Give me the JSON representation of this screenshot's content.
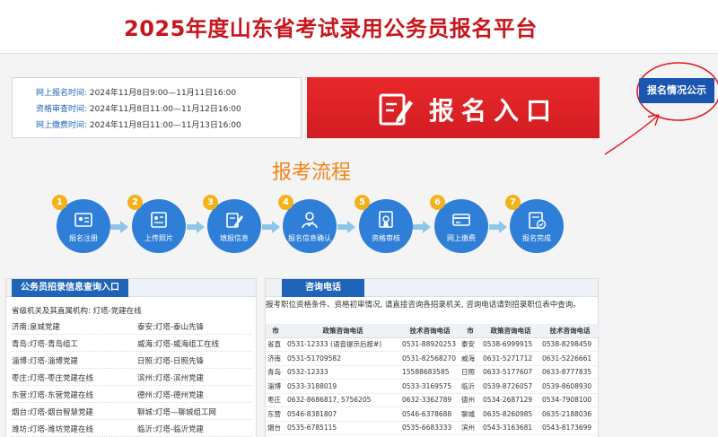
{
  "header": {
    "title": "2025年度山东省考试录用公务员报名平台"
  },
  "schedule": [
    {
      "label": "网上报名时间:",
      "value": "2024年11月8日9:00—11月11日16:00"
    },
    {
      "label": "资格审查时间:",
      "value": "2024年11月8日11:00—11月12日16:00"
    },
    {
      "label": "网上缴费时间:",
      "value": "2024年11月8日11:00—11月13日16:00"
    }
  ],
  "entry_button": {
    "label": "报名入口",
    "icon": "edit-form-icon"
  },
  "publicity_button": {
    "label": "报名情况公示"
  },
  "annotation": {
    "color": "#e0161d"
  },
  "flow": {
    "title": "报考流程",
    "steps": [
      {
        "num": "1",
        "label": "报名注册",
        "icon": "id-card-icon"
      },
      {
        "num": "2",
        "label": "上传照片",
        "icon": "photo-icon"
      },
      {
        "num": "3",
        "label": "填报信息",
        "icon": "write-icon"
      },
      {
        "num": "4",
        "label": "报名信息确认",
        "icon": "user-confirm-icon"
      },
      {
        "num": "5",
        "label": "资格审核",
        "icon": "certificate-icon"
      },
      {
        "num": "6",
        "label": "网上缴费",
        "icon": "payment-card-icon"
      },
      {
        "num": "7",
        "label": "报名完成",
        "icon": "check-document-icon"
      }
    ]
  },
  "left_panel": {
    "tab": "公务员招录信息查询入口",
    "intro": "省级机关及其直属机构:  灯塔-党建在线",
    "rows": [
      [
        {
          "city": "济南:",
          "link": "泉城党建"
        },
        {
          "city": "泰安:",
          "link": "灯塔-泰山先锋"
        }
      ],
      [
        {
          "city": "青岛:",
          "link": "灯塔-青岛组工"
        },
        {
          "city": "威海:",
          "link": "灯塔-威海组工在线"
        }
      ],
      [
        {
          "city": "淄博:",
          "link": "灯塔-淄博党建"
        },
        {
          "city": "日照:",
          "link": "灯塔-日照先锋"
        }
      ],
      [
        {
          "city": "枣庄:",
          "link": "灯塔-枣庄党建在线"
        },
        {
          "city": "滨州:",
          "link": "灯塔-滨州党建"
        }
      ],
      [
        {
          "city": "东营:",
          "link": "灯塔-东营党建在线"
        },
        {
          "city": "德州:",
          "link": "灯塔-德州党建"
        }
      ],
      [
        {
          "city": "烟台:",
          "link": "灯塔-烟台智慧党建"
        },
        {
          "city": "聊城:",
          "link": "灯塔—聊城组工网"
        }
      ],
      [
        {
          "city": "潍坊:",
          "link": "灯塔-潍坊党建在线"
        },
        {
          "city": "临沂:",
          "link": "灯塔-临沂党建"
        }
      ]
    ]
  },
  "right_panel": {
    "tab": "咨询电话",
    "note": "报考职位资格条件、资格初审情况, 请直接咨询各招录机关, 咨询电话请到招录职位表中查询。",
    "headers": [
      "市",
      "政策咨询电话",
      "技术咨询电话",
      "市",
      "政策咨询电话",
      "技术咨询电话"
    ],
    "rows": [
      [
        "省直",
        "0531-12333 (语音提示后按#)",
        "0531-88920253",
        "泰安",
        "0538-6999915",
        "0538-8298459"
      ],
      [
        "济南",
        "0531-51709582",
        "0531-82568270",
        "威海",
        "0631-5271712",
        "0631-5226661"
      ],
      [
        "青岛",
        "0532-12333",
        "15588683585",
        "日照",
        "0633-5177607",
        "0633-8777835"
      ],
      [
        "淄博",
        "0533-3188019",
        "0533-3169575",
        "临沂",
        "0539-8726057",
        "0539-8608930"
      ],
      [
        "枣庄",
        "0632-8686817, 5756205",
        "0632-3362789",
        "德州",
        "0534-2687129",
        "0534-7908100"
      ],
      [
        "东营",
        "0546-8381807",
        "0546-6378688",
        "聊城",
        "0635-8260985",
        "0635-2188036"
      ],
      [
        "烟台",
        "0535-6785115",
        "0535-6683333",
        "滨州",
        "0543-3163681",
        "0543-8173699"
      ]
    ]
  }
}
